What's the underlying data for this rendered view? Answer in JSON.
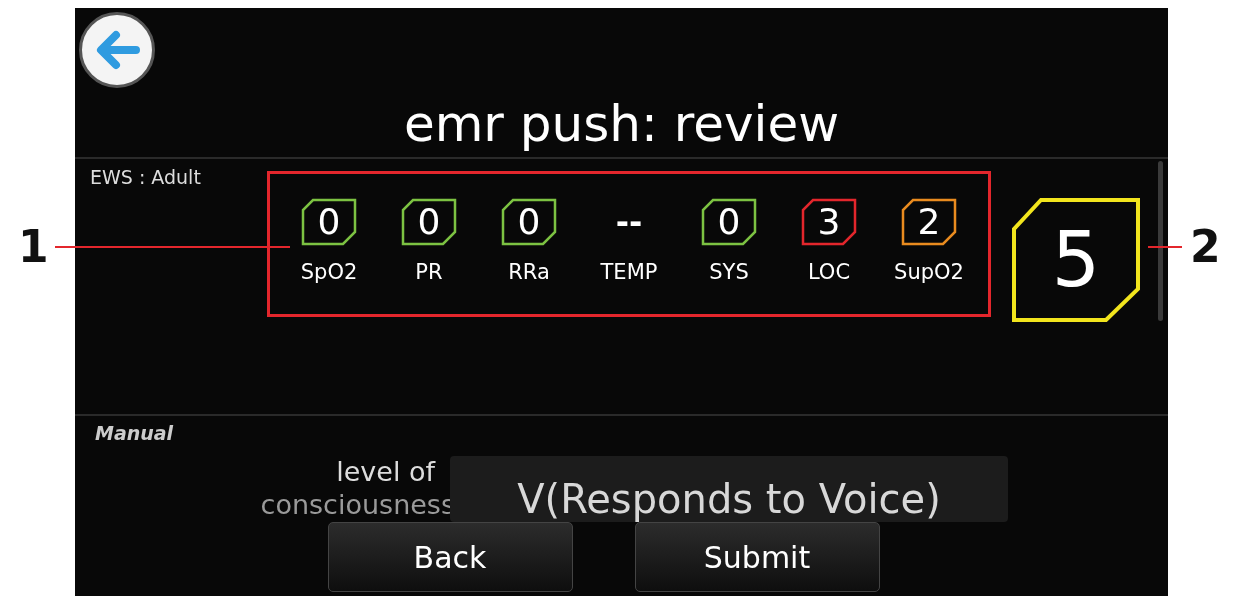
{
  "header": {
    "title": "emr push: review"
  },
  "ews": {
    "label": "EWS : Adult",
    "params": [
      {
        "name": "SpO2",
        "kind": "badge",
        "score": "0",
        "color": "#7cc242"
      },
      {
        "name": "PR",
        "kind": "badge",
        "score": "0",
        "color": "#7cc242"
      },
      {
        "name": "RRa",
        "kind": "badge",
        "score": "0",
        "color": "#7cc242"
      },
      {
        "name": "TEMP",
        "kind": "plain",
        "score": "--"
      },
      {
        "name": "SYS",
        "kind": "badge",
        "score": "0",
        "color": "#7cc242"
      },
      {
        "name": "LOC",
        "kind": "badge",
        "score": "3",
        "color": "#e3262c"
      },
      {
        "name": "SupO2",
        "kind": "badge",
        "score": "2",
        "color": "#e98b1f"
      }
    ],
    "total": "5"
  },
  "manual": {
    "label": "Manual",
    "field_label_1": "level of",
    "field_label_2": "consciousness",
    "value": "V(Responds to Voice)"
  },
  "buttons": [
    "Back",
    "Submit"
  ],
  "callouts": [
    {
      "number": "1"
    },
    {
      "number": "2"
    }
  ]
}
